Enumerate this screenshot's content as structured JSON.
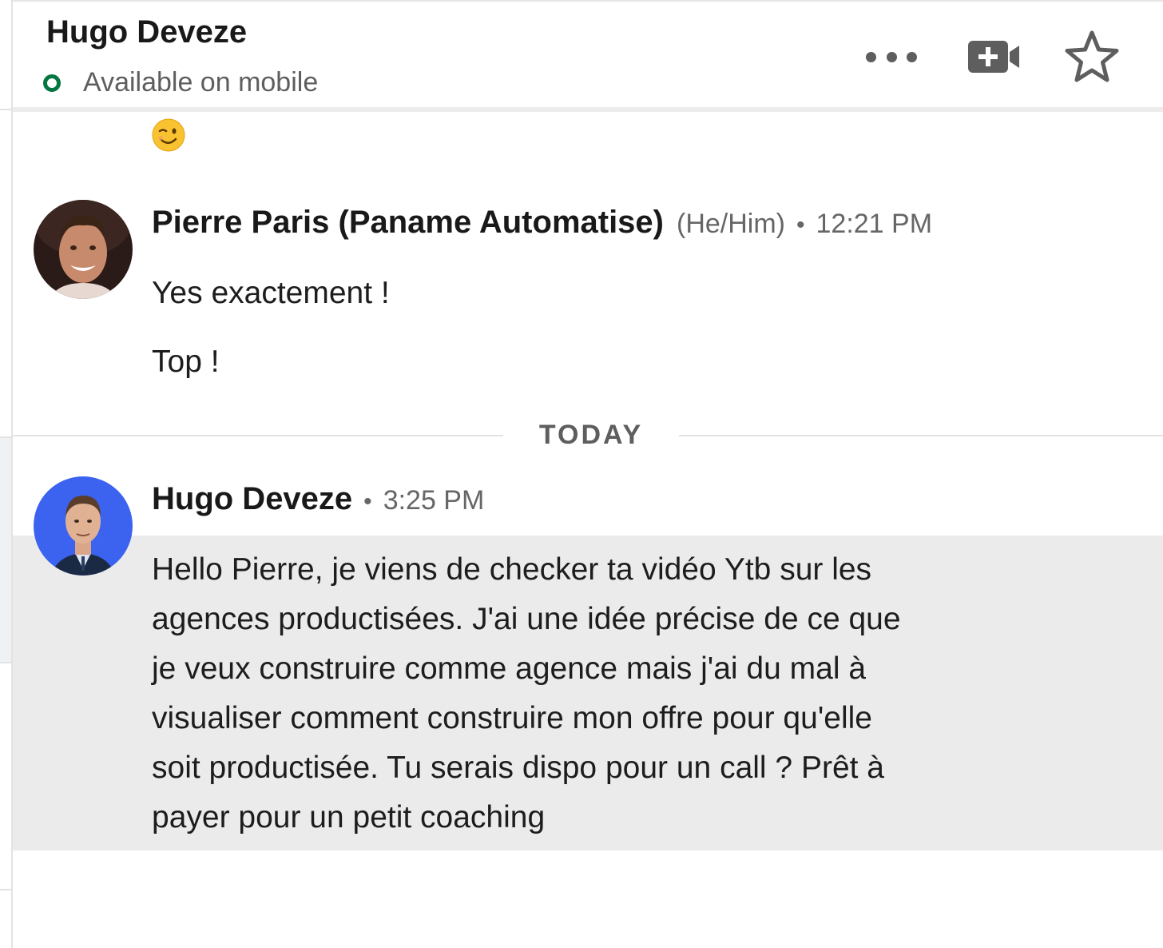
{
  "header": {
    "contact_name": "Hugo Deveze",
    "presence": "Available on mobile",
    "icons": [
      "more-icon",
      "video-call-icon",
      "star-icon"
    ]
  },
  "messages": [
    {
      "sender": "Pierre Paris (Paname Automatise)",
      "pronoun": "(He/Him)",
      "time": "12:21 PM",
      "lines": [
        "Yes exactement !",
        "Top !"
      ]
    },
    {
      "sender": "Hugo Deveze",
      "time": "3:25 PM",
      "text_lines": [
        "Hello Pierre, je viens de checker ta vidéo Ytb sur les",
        "agences productisées. J'ai une idée précise de ce que",
        "je veux construire comme agence mais j'ai du mal à",
        "visualiser comment construire mon offre pour qu'elle",
        "soit productisée. Tu serais dispo pour un call ? Prêt à",
        "payer pour un petit coaching"
      ]
    }
  ],
  "divider": {
    "label": "TODAY"
  },
  "colors": {
    "presence": "#057642",
    "highlight": "#ebebeb",
    "avatar_blue": "#3b63f0"
  },
  "emoji": "winking-face"
}
